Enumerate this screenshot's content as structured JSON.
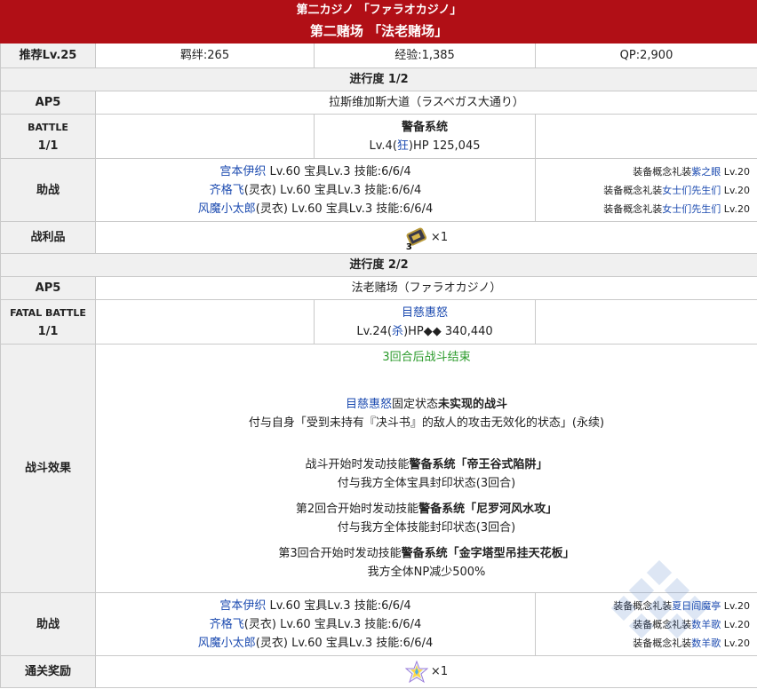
{
  "header": {
    "title_jp": "第二カジノ 「ファラオカジノ」",
    "title_cn": "第二赌场 「法老赌场」"
  },
  "stats": {
    "level": "推荐Lv.25",
    "bond": "羁绊:265",
    "exp": "经验:1,385",
    "qp": "QP:2,900"
  },
  "stage1": {
    "progress": "进行度 1/2",
    "ap_label": "AP5",
    "location": "拉斯维加斯大道（ラスベガス大通り）",
    "battle_label": "BATTLE",
    "battle_count": "1/1",
    "enemy_name": "警备系统",
    "enemy_level_prefix": "Lv.4(",
    "enemy_class": "狂",
    "enemy_level_suffix": ")HP 125,045",
    "support_label": "助战",
    "supports": [
      {
        "servant": "宫本伊织",
        "stats": " Lv.60 宝具Lv.3 技能:6/6/4",
        "ce_prefix": "装备概念礼装",
        "ce_name": "紫之眼",
        "ce_level": " Lv.20"
      },
      {
        "servant": "齐格飞",
        "costume": "(灵衣)",
        "stats": " Lv.60 宝具Lv.3 技能:6/6/4",
        "ce_prefix": "装备概念礼装",
        "ce_name": "女士们先生们",
        "ce_level": " Lv.20"
      },
      {
        "servant": "风魔小太郎",
        "costume": "(灵衣)",
        "stats": " Lv.60 宝具Lv.3 技能:6/6/4",
        "ce_prefix": "装备概念礼装",
        "ce_name": "女士们先生们",
        "ce_level": " Lv.20"
      }
    ],
    "drop_label": "战利品",
    "drop_badge": "3",
    "drop_count": "×1"
  },
  "stage2": {
    "progress": "进行度 2/2",
    "ap_label": "AP5",
    "location": "法老赌场（ファラオカジノ）",
    "battle_label": "FATAL BATTLE",
    "battle_count": "1/1",
    "enemy_name": "目慈惠怒",
    "enemy_level_prefix": "Lv.24(",
    "enemy_class": "杀",
    "enemy_level_suffix": ")HP◆◆ 340,440",
    "effects_label": "战斗效果",
    "effects": {
      "turn_limit": "3回合后战斗结束",
      "fixed_name": "目慈惠怒",
      "fixed_mid": "固定状态",
      "fixed_bold": "未实现的战斗",
      "fixed_desc": "付与自身「受到未持有『决斗书』的敌人的攻击无效化的状态」(永续)",
      "skill1_prefix": "战斗开始时发动技能",
      "skill1_name": "警备系统「帝王谷式陷阱」",
      "skill1_desc": "付与我方全体宝具封印状态(3回合)",
      "skill2_prefix": "第2回合开始时发动技能",
      "skill2_name": "警备系统「尼罗河风水攻」",
      "skill2_desc": "付与我方全体技能封印状态(3回合)",
      "skill3_prefix": "第3回合开始时发动技能",
      "skill3_name": "警备系统「金字塔型吊挂天花板」",
      "skill3_desc": "我方全体NP减少500%"
    },
    "support_label": "助战",
    "supports": [
      {
        "servant": "宫本伊织",
        "stats": " Lv.60 宝具Lv.3 技能:6/6/4",
        "ce_prefix": "装备概念礼装",
        "ce_name": "夏日阎魔亭",
        "ce_level": " Lv.20"
      },
      {
        "servant": "齐格飞",
        "costume": "(灵衣)",
        "stats": " Lv.60 宝具Lv.3 技能:6/6/4",
        "ce_prefix": "装备概念礼装",
        "ce_name": "数羊歌",
        "ce_level": " Lv.20"
      },
      {
        "servant": "风魔小太郎",
        "costume": "(灵衣)",
        "stats": " Lv.60 宝具Lv.3 技能:6/6/4",
        "ce_prefix": "装备概念礼装",
        "ce_name": "数羊歌",
        "ce_level": " Lv.20"
      }
    ],
    "reward_label": "通关奖励",
    "reward_count": "×1"
  },
  "colors": {
    "header_red": "#b10f16",
    "label_bg": "#f0f0f0",
    "link_blue": "#1c4bb0",
    "green": "#2a9a2a"
  }
}
